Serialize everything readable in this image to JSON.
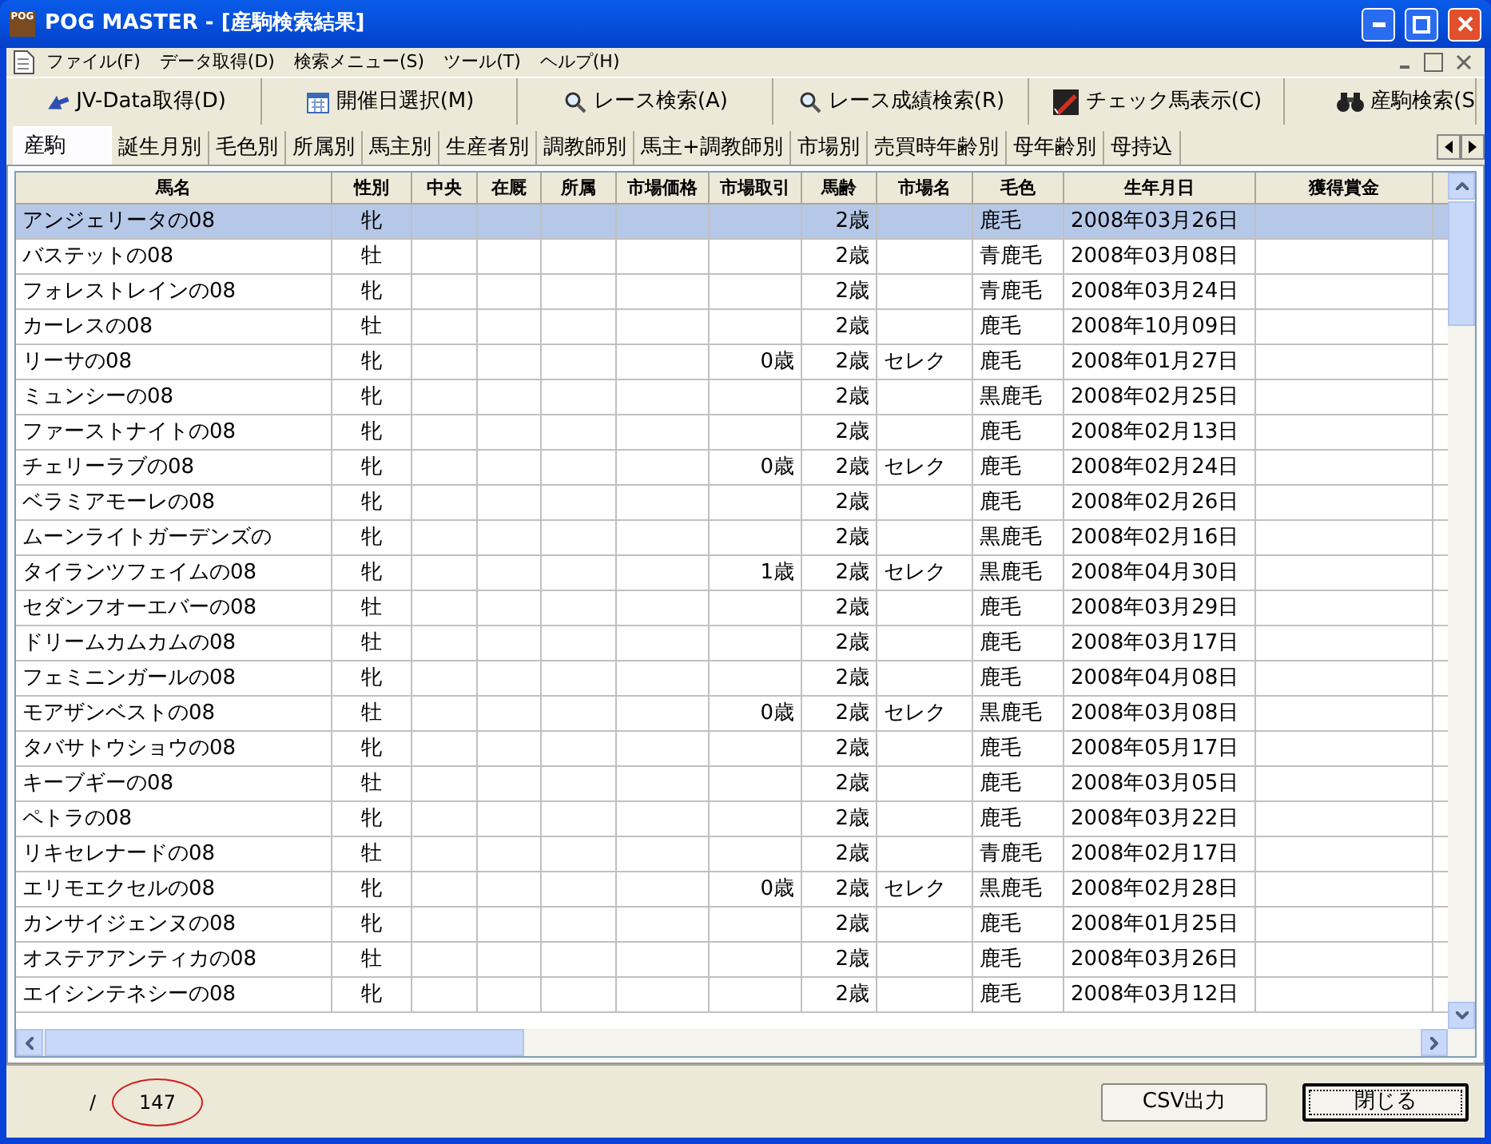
{
  "window": {
    "title": "POG MASTER - [産駒検索結果]",
    "app_icon_text": "POG"
  },
  "menu": [
    "ファイル(F)",
    "データ取得(D)",
    "検索メニュー(S)",
    "ツール(T)",
    "ヘルプ(H)"
  ],
  "toolbar": [
    {
      "label": "JV-Data取得(D)",
      "kind": "arrow"
    },
    {
      "label": "開催日選択(M)",
      "kind": "calendar"
    },
    {
      "label": "レース検索(A)",
      "kind": "search"
    },
    {
      "label": "レース成績検索(R)",
      "kind": "search"
    },
    {
      "label": "チェック馬表示(C)",
      "kind": "check"
    },
    {
      "label": "産駒検索(S",
      "kind": "binoculars"
    }
  ],
  "tabs": [
    {
      "label": "産駒",
      "selected": true
    },
    {
      "label": "誕生月別",
      "selected": false
    },
    {
      "label": "毛色別",
      "selected": false
    },
    {
      "label": "所属別",
      "selected": false
    },
    {
      "label": "馬主別",
      "selected": false
    },
    {
      "label": "生産者別",
      "selected": false
    },
    {
      "label": "調教師別",
      "selected": false
    },
    {
      "label": "馬主+調教師別",
      "selected": false
    },
    {
      "label": "市場別",
      "selected": false
    },
    {
      "label": "売買時年齢別",
      "selected": false
    },
    {
      "label": "母年齢別",
      "selected": false
    },
    {
      "label": "母持込",
      "selected": false
    }
  ],
  "table": {
    "columns": [
      "馬名",
      "性別",
      "中央",
      "在厩",
      "所属",
      "市場価格",
      "市場取引",
      "馬齢",
      "市場名",
      "毛色",
      "生年月日",
      "獲得賞金"
    ],
    "rows": [
      {
        "selected": true,
        "cells": [
          "アンジェリータの08",
          "牝",
          "",
          "",
          "",
          "",
          "",
          "2歳",
          "",
          "鹿毛",
          "2008年03月26日",
          ""
        ]
      },
      {
        "selected": false,
        "cells": [
          "バステットの08",
          "牡",
          "",
          "",
          "",
          "",
          "",
          "2歳",
          "",
          "青鹿毛",
          "2008年03月08日",
          ""
        ]
      },
      {
        "selected": false,
        "cells": [
          "フォレストレインの08",
          "牝",
          "",
          "",
          "",
          "",
          "",
          "2歳",
          "",
          "青鹿毛",
          "2008年03月24日",
          ""
        ]
      },
      {
        "selected": false,
        "cells": [
          "カーレスの08",
          "牡",
          "",
          "",
          "",
          "",
          "",
          "2歳",
          "",
          "鹿毛",
          "2008年10月09日",
          ""
        ]
      },
      {
        "selected": false,
        "cells": [
          "リーサの08",
          "牝",
          "",
          "",
          "",
          "",
          "0歳",
          "2歳",
          "セレク",
          "鹿毛",
          "2008年01月27日",
          ""
        ]
      },
      {
        "selected": false,
        "cells": [
          "ミュンシーの08",
          "牝",
          "",
          "",
          "",
          "",
          "",
          "2歳",
          "",
          "黒鹿毛",
          "2008年02月25日",
          ""
        ]
      },
      {
        "selected": false,
        "cells": [
          "ファーストナイトの08",
          "牝",
          "",
          "",
          "",
          "",
          "",
          "2歳",
          "",
          "鹿毛",
          "2008年02月13日",
          ""
        ]
      },
      {
        "selected": false,
        "cells": [
          "チェリーラブの08",
          "牝",
          "",
          "",
          "",
          "",
          "0歳",
          "2歳",
          "セレク",
          "鹿毛",
          "2008年02月24日",
          ""
        ]
      },
      {
        "selected": false,
        "cells": [
          "ベラミアモーレの08",
          "牝",
          "",
          "",
          "",
          "",
          "",
          "2歳",
          "",
          "鹿毛",
          "2008年02月26日",
          ""
        ]
      },
      {
        "selected": false,
        "cells": [
          "ムーンライトガーデンズの",
          "牝",
          "",
          "",
          "",
          "",
          "",
          "2歳",
          "",
          "黒鹿毛",
          "2008年02月16日",
          ""
        ]
      },
      {
        "selected": false,
        "cells": [
          "タイランツフェイムの08",
          "牝",
          "",
          "",
          "",
          "",
          "1歳",
          "2歳",
          "セレク",
          "黒鹿毛",
          "2008年04月30日",
          ""
        ]
      },
      {
        "selected": false,
        "cells": [
          "セダンフオーエバーの08",
          "牡",
          "",
          "",
          "",
          "",
          "",
          "2歳",
          "",
          "鹿毛",
          "2008年03月29日",
          ""
        ]
      },
      {
        "selected": false,
        "cells": [
          "ドリームカムカムの08",
          "牡",
          "",
          "",
          "",
          "",
          "",
          "2歳",
          "",
          "鹿毛",
          "2008年03月17日",
          ""
        ]
      },
      {
        "selected": false,
        "cells": [
          "フェミニンガールの08",
          "牝",
          "",
          "",
          "",
          "",
          "",
          "2歳",
          "",
          "鹿毛",
          "2008年04月08日",
          ""
        ]
      },
      {
        "selected": false,
        "cells": [
          "モアザンベストの08",
          "牡",
          "",
          "",
          "",
          "",
          "0歳",
          "2歳",
          "セレク",
          "黒鹿毛",
          "2008年03月08日",
          ""
        ]
      },
      {
        "selected": false,
        "cells": [
          "タバサトウショウの08",
          "牝",
          "",
          "",
          "",
          "",
          "",
          "2歳",
          "",
          "鹿毛",
          "2008年05月17日",
          ""
        ]
      },
      {
        "selected": false,
        "cells": [
          "キーブギーの08",
          "牡",
          "",
          "",
          "",
          "",
          "",
          "2歳",
          "",
          "鹿毛",
          "2008年03月05日",
          ""
        ]
      },
      {
        "selected": false,
        "cells": [
          "ペトラの08",
          "牝",
          "",
          "",
          "",
          "",
          "",
          "2歳",
          "",
          "鹿毛",
          "2008年03月22日",
          ""
        ]
      },
      {
        "selected": false,
        "cells": [
          "リキセレナードの08",
          "牡",
          "",
          "",
          "",
          "",
          "",
          "2歳",
          "",
          "青鹿毛",
          "2008年02月17日",
          ""
        ]
      },
      {
        "selected": false,
        "cells": [
          "エリモエクセルの08",
          "牝",
          "",
          "",
          "",
          "",
          "0歳",
          "2歳",
          "セレク",
          "黒鹿毛",
          "2008年02月28日",
          ""
        ]
      },
      {
        "selected": false,
        "cells": [
          "カンサイジェンヌの08",
          "牝",
          "",
          "",
          "",
          "",
          "",
          "2歳",
          "",
          "鹿毛",
          "2008年01月25日",
          ""
        ]
      },
      {
        "selected": false,
        "cells": [
          "オステアアンティカの08",
          "牡",
          "",
          "",
          "",
          "",
          "",
          "2歳",
          "",
          "鹿毛",
          "2008年03月26日",
          ""
        ]
      },
      {
        "selected": false,
        "cells": [
          "エイシンテネシーの08",
          "牝",
          "",
          "",
          "",
          "",
          "",
          "2歳",
          "",
          "鹿毛",
          "2008年03月12日",
          ""
        ]
      }
    ]
  },
  "footer": {
    "separator": "/",
    "count": "147",
    "buttons": [
      {
        "label": "CSV出力",
        "focused": false
      },
      {
        "label": "閉じる",
        "focused": true
      }
    ]
  }
}
